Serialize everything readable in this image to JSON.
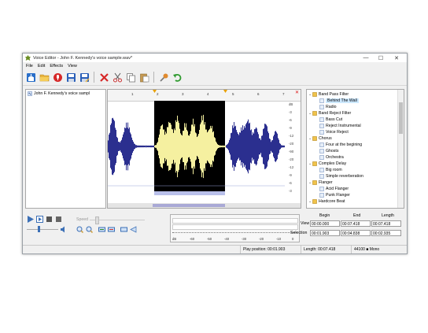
{
  "window": {
    "title": "Voice Editor - John F. Kennedy's voice sample.wav*",
    "min_glyph": "—",
    "max_glyph": "☐",
    "close_glyph": "✕"
  },
  "menu": [
    "File",
    "Edit",
    "Effects",
    "View"
  ],
  "toolbar": {
    "icons": [
      "import-icon",
      "open-folder-icon",
      "record-icon",
      "save-icon",
      "save-as-icon",
      "delete-icon",
      "cut-icon",
      "copy-icon",
      "paste-icon",
      "microphone-icon",
      "undo-icon"
    ]
  },
  "files": {
    "items": [
      {
        "label": "John F. Kennedy's voice sampl"
      }
    ]
  },
  "ruler": {
    "labels": [
      "1",
      "2",
      "3",
      "4",
      "5",
      "6",
      "7"
    ],
    "close_glyph": "✕"
  },
  "db_scale": [
    "dB",
    "-3",
    "-6",
    "-9",
    "-12",
    "-20",
    "-90",
    "-20",
    "-12",
    "-9",
    "-6",
    "-3"
  ],
  "effects": {
    "items": [
      {
        "label": "Band Pass Filter",
        "type": "group"
      },
      {
        "label": "Behind The Wall",
        "type": "item",
        "selected": true
      },
      {
        "label": "Radio",
        "type": "item"
      },
      {
        "label": "Band Reject Filter",
        "type": "group"
      },
      {
        "label": "Bass Cut",
        "type": "item"
      },
      {
        "label": "Reject Instrumental",
        "type": "item"
      },
      {
        "label": "Voice Reject",
        "type": "item"
      },
      {
        "label": "Chorus",
        "type": "group"
      },
      {
        "label": "Four at the begining",
        "type": "item"
      },
      {
        "label": "Ghosts",
        "type": "item"
      },
      {
        "label": "Orchestra",
        "type": "item"
      },
      {
        "label": "Complex Delay",
        "type": "group"
      },
      {
        "label": "Big room",
        "type": "item"
      },
      {
        "label": "Simple reverberation",
        "type": "item"
      },
      {
        "label": "Flanger",
        "type": "group"
      },
      {
        "label": "Acid Flanger",
        "type": "item"
      },
      {
        "label": "Punk Flanger",
        "type": "item"
      },
      {
        "label": "Hardcore Beat",
        "type": "group"
      }
    ]
  },
  "transport": {
    "speed_label": "Speed"
  },
  "meter": {
    "scale": [
      "dB",
      "-60",
      "-50",
      "-40",
      "-30",
      "-20",
      "-10",
      "0"
    ]
  },
  "times": {
    "begin_label": "Begin",
    "end_label": "End",
    "length_label": "Length",
    "view_label": "View",
    "selection_label": "Selection",
    "view_begin": "00:00.000",
    "view_end": "00:07.418",
    "view_length": "00:07.418",
    "sel_begin": "00:01.903",
    "sel_end": "00:04.838",
    "sel_length": "00:02.935"
  },
  "status": {
    "play_position": "Play position: 00:01.903",
    "length": "Length: 00:07.418",
    "format": "44100 ■ Mono"
  },
  "colors": {
    "waveform": "#2b2f8f",
    "selected_waveform": "#f5f0a0",
    "selection_bg": "#000000",
    "accent": "#1e64c8"
  }
}
